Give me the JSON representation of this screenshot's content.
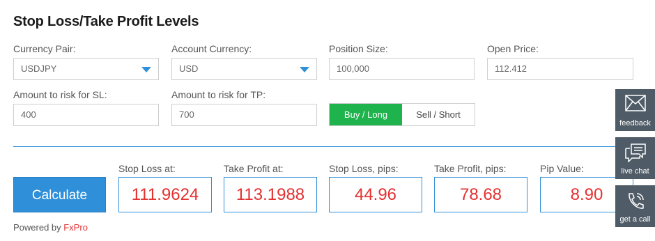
{
  "title": "Stop Loss/Take Profit Levels",
  "fields": {
    "currency_pair": {
      "label": "Currency Pair:",
      "value": "USDJPY"
    },
    "account_currency": {
      "label": "Account Currency:",
      "value": "USD"
    },
    "position_size": {
      "label": "Position Size:",
      "value": "100,000"
    },
    "open_price": {
      "label": "Open Price:",
      "value": "112.412"
    },
    "risk_sl": {
      "label": "Amount to risk for SL:",
      "value": "400"
    },
    "risk_tp": {
      "label": "Amount to risk for TP:",
      "value": "700"
    }
  },
  "direction": {
    "options": [
      "Buy / Long",
      "Sell / Short"
    ],
    "selected": "Buy / Long"
  },
  "calculate_label": "Calculate",
  "results": [
    {
      "label": "Stop Loss at:",
      "value": "111.9624"
    },
    {
      "label": "Take Profit at:",
      "value": "113.1988"
    },
    {
      "label": "Stop Loss, pips:",
      "value": "44.96"
    },
    {
      "label": "Take Profit, pips:",
      "value": "78.68"
    },
    {
      "label": "Pip Value:",
      "value": "8.90"
    }
  ],
  "footer": {
    "prefix": "Powered by ",
    "brand": "FxPro"
  },
  "side_buttons": [
    {
      "label": "feedback",
      "icon": "envelope-icon"
    },
    {
      "label": "live chat",
      "icon": "chat-bubble-icon"
    },
    {
      "label": "get a call",
      "icon": "phone-icon"
    }
  ],
  "colors": {
    "accent": "#2f8fd8",
    "active_toggle": "#1fb34e",
    "result_text": "#e53030",
    "side_panel": "#4f5b66"
  }
}
